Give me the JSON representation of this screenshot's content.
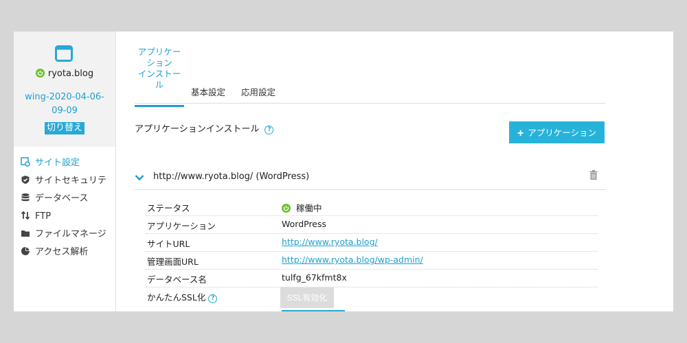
{
  "sidebar": {
    "server_name": "ryota.blog",
    "server_id": "wing-2020-04-06-09-09",
    "switch_label": "切り替え",
    "menu": [
      {
        "label": "サイト設定",
        "icon": "gear-window-icon",
        "active": true
      },
      {
        "label": "サイトセキュリテ",
        "icon": "shield-check-icon",
        "active": false
      },
      {
        "label": "データベース",
        "icon": "database-icon",
        "active": false
      },
      {
        "label": "FTP",
        "icon": "transfer-arrows-icon",
        "active": false
      },
      {
        "label": "ファイルマネージ",
        "icon": "folder-icon",
        "active": false
      },
      {
        "label": "アクセス解析",
        "icon": "pie-chart-icon",
        "active": false
      }
    ]
  },
  "tabs": {
    "install": "アプリケーションインストール",
    "install_lines": [
      "アプリケー",
      "ション",
      "インストー",
      "ル"
    ],
    "basic": "基本設定",
    "advanced": "応用設定"
  },
  "section": {
    "title": "アプリケーションインストール",
    "add_button": "アプリケーション"
  },
  "application": {
    "url_label": "http://www.ryota.blog/ (WordPress)",
    "rows": [
      {
        "key": "ステータス",
        "value": "稼働中"
      },
      {
        "key": "アプリケーション",
        "value": "WordPress"
      },
      {
        "key": "サイトURL",
        "value": "http://www.ryota.blog/"
      },
      {
        "key": "管理画面URL",
        "value": "http://www.ryota.blog/wp-admin/"
      },
      {
        "key": "データベース名",
        "value": "tulfg_67kfmt8x"
      },
      {
        "key": "かんたんSSL化",
        "value": "SSL有効化"
      }
    ]
  },
  "colors": {
    "accent": "#27a9d6",
    "status_green": "#6cbf2b",
    "background": "#d6d6d6"
  }
}
